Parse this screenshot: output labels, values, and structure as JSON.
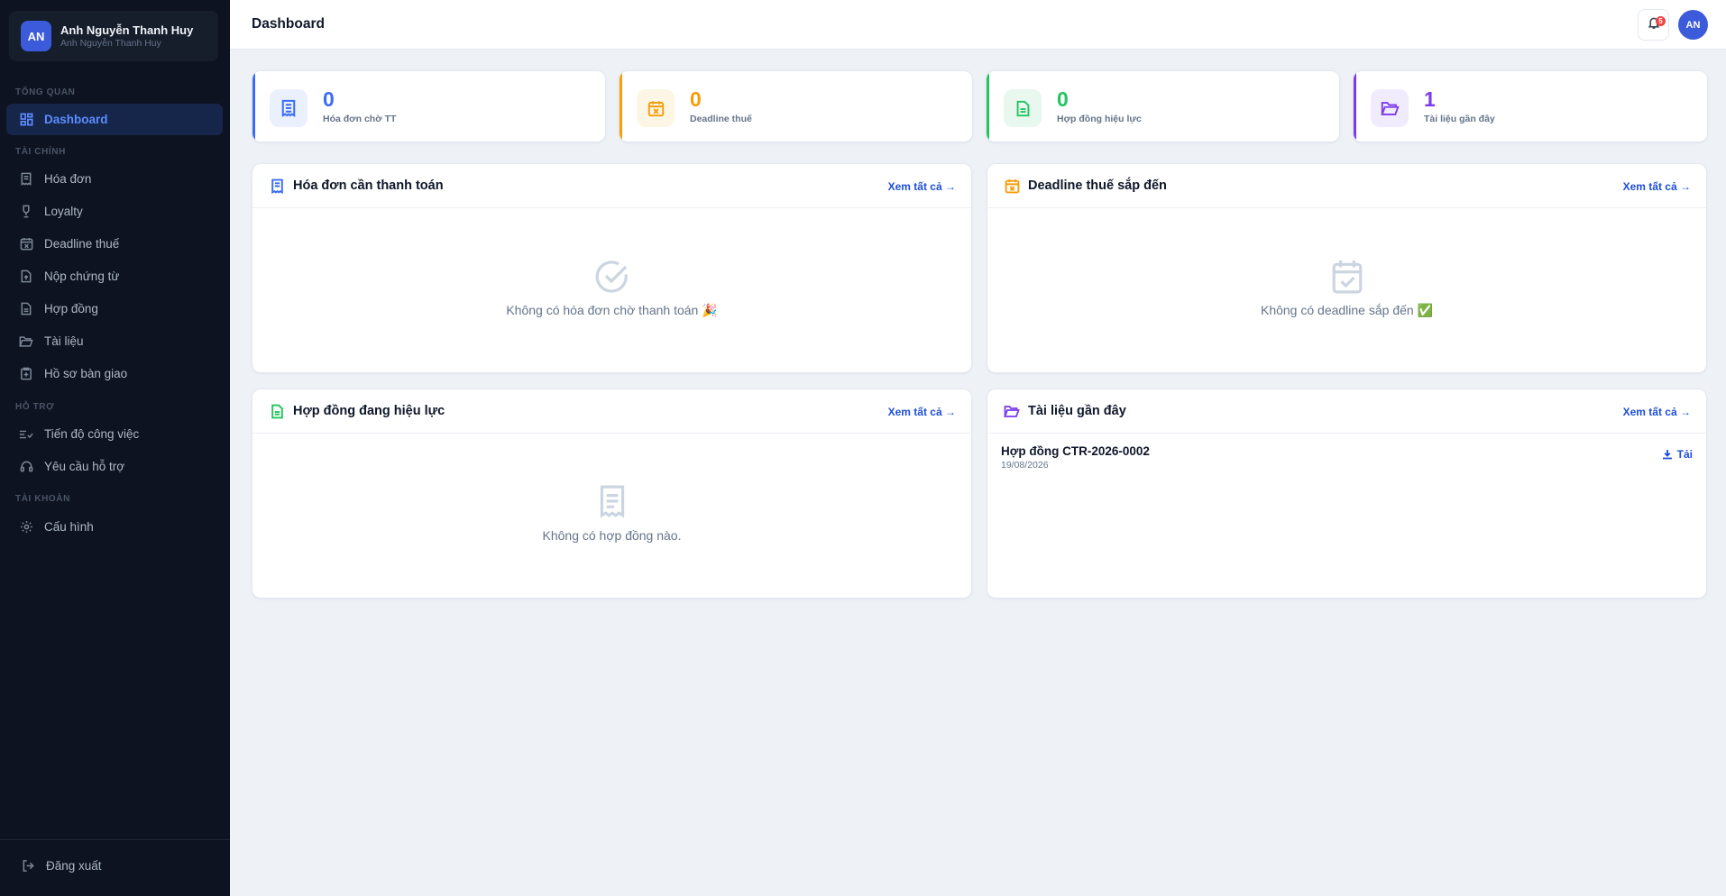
{
  "user": {
    "initials": "AN",
    "name": "Anh Nguyễn Thanh Huy",
    "subtitle": "Anh Nguyễn Thanh Huy"
  },
  "sidebar": {
    "sections": {
      "overview": "TỔNG QUAN",
      "finance": "TÀI CHÍNH",
      "support": "HỖ TRỢ",
      "account": "TÀI KHOẢN"
    },
    "items": {
      "dashboard": "Dashboard",
      "invoices": "Hóa đơn",
      "loyalty": "Loyalty",
      "tax_deadline": "Deadline thuế",
      "submit_docs": "Nộp chứng từ",
      "contracts": "Hợp đồng",
      "documents": "Tài liệu",
      "handover": "Hồ sơ bàn giao",
      "progress": "Tiến độ công việc",
      "support_request": "Yêu cầu hỗ trợ",
      "settings": "Cấu hình"
    },
    "logout": "Đăng xuất"
  },
  "header": {
    "title": "Dashboard",
    "notification_count": "5",
    "avatar_initials": "AN"
  },
  "stats": [
    {
      "value": "0",
      "label": "Hóa đơn chờ TT",
      "color": "#3b6cf6"
    },
    {
      "value": "0",
      "label": "Deadline thuế",
      "color": "#f59e0b"
    },
    {
      "value": "0",
      "label": "Hợp đồng hiệu lực",
      "color": "#22c55e"
    },
    {
      "value": "1",
      "label": "Tài liệu gần đây",
      "color": "#7c3aed"
    }
  ],
  "panels": {
    "invoices": {
      "title": "Hóa đơn cần thanh toán",
      "see_all": "Xem tất cả →",
      "empty_text": "Không có hóa đơn chờ thanh toán 🎉"
    },
    "tax": {
      "title": "Deadline thuế sắp đến",
      "see_all": "Xem tất cả →",
      "empty_text": "Không có deadline sắp đến ✅"
    },
    "contracts": {
      "title": "Hợp đồng đang hiệu lực",
      "see_all": "Xem tất cả →",
      "empty_text": "Không có hợp đồng nào."
    },
    "documents": {
      "title": "Tài liệu gần đây",
      "see_all": "Xem tất cả →",
      "items": [
        {
          "name": "Hợp đồng CTR-2026-0002",
          "date": "19/08/2026",
          "action": "Tải"
        }
      ]
    }
  },
  "colors": {
    "sidebar_bg": "#0d1320",
    "accent": "#3b5bdb",
    "link": "#1d4ed8",
    "page_bg": "#eef1f5"
  }
}
